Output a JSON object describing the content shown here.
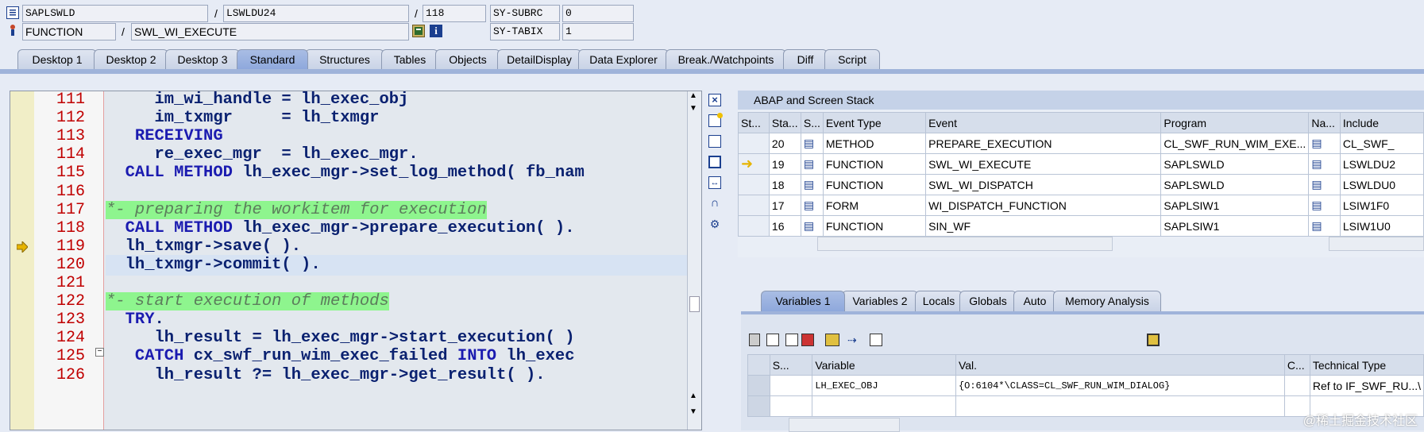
{
  "header": {
    "program": "SAPLSWLD",
    "include": "LSWLDU24",
    "line": "118",
    "sy_subrc_label": "SY-SUBRC",
    "sy_subrc_value": "0",
    "event_type": "FUNCTION",
    "event": "SWL_WI_EXECUTE",
    "sy_tabix_label": "SY-TABIX",
    "sy_tabix_value": "1",
    "slash": "/"
  },
  "tabs": [
    {
      "label": "Desktop 1"
    },
    {
      "label": "Desktop 2"
    },
    {
      "label": "Desktop 3"
    },
    {
      "label": "Standard",
      "active": true
    },
    {
      "label": "Structures"
    },
    {
      "label": "Tables"
    },
    {
      "label": "Objects"
    },
    {
      "label": "DetailDisplay"
    },
    {
      "label": "Data Explorer"
    },
    {
      "label": "Break./Watchpoints"
    },
    {
      "label": "Diff"
    },
    {
      "label": "Script"
    }
  ],
  "code": {
    "current_line": "118",
    "lines": [
      {
        "num": "111",
        "text": "     im_wi_handle = lh_exec_obj"
      },
      {
        "num": "112",
        "text": "     im_txmgr     = lh_txmgr"
      },
      {
        "num": "113",
        "text": "   RECEIVING"
      },
      {
        "num": "114",
        "text": "     re_exec_mgr  = lh_exec_mgr."
      },
      {
        "num": "115",
        "text": "  CALL METHOD lh_exec_mgr->set_log_method( fb_nam"
      },
      {
        "num": "116",
        "text": ""
      },
      {
        "num": "117",
        "text": "*- preparing the workitem for execution"
      },
      {
        "num": "118",
        "text": "  CALL METHOD lh_exec_mgr->prepare_execution( )."
      },
      {
        "num": "119",
        "text": "  lh_txmgr->save( )."
      },
      {
        "num": "120",
        "text": "  lh_txmgr->commit( )."
      },
      {
        "num": "121",
        "text": ""
      },
      {
        "num": "122",
        "text": "*- start execution of methods"
      },
      {
        "num": "123",
        "text": "  TRY."
      },
      {
        "num": "124",
        "text": "     lh_result = lh_exec_mgr->start_execution( )"
      },
      {
        "num": "125",
        "text": "   CATCH cx_swf_run_wim_exec_failed INTO lh_exec"
      },
      {
        "num": "126",
        "text": "     lh_result ?= lh_exec_mgr->get_result( )."
      }
    ]
  },
  "stack": {
    "title": "ABAP and Screen Stack",
    "columns": [
      "St...",
      "Sta...",
      "S...",
      "Event Type",
      "Event",
      "Program",
      "Na...",
      "Include"
    ],
    "rows": [
      {
        "level": "20",
        "type": "METHOD",
        "event": "PREPARE_EXECUTION",
        "program": "CL_SWF_RUN_WIM_EXE...",
        "include": "CL_SWF_",
        "current": false
      },
      {
        "level": "19",
        "type": "FUNCTION",
        "event": "SWL_WI_EXECUTE",
        "program": "SAPLSWLD",
        "include": "LSWLDU2",
        "current": true
      },
      {
        "level": "18",
        "type": "FUNCTION",
        "event": "SWL_WI_DISPATCH",
        "program": "SAPLSWLD",
        "include": "LSWLDU0",
        "current": false
      },
      {
        "level": "17",
        "type": "FORM",
        "event": "WI_DISPATCH_FUNCTION",
        "program": "SAPLSIW1",
        "include": "LSIW1F0",
        "current": false
      },
      {
        "level": "16",
        "type": "FUNCTION",
        "event": "SIN_WF",
        "program": "SAPLSIW1",
        "include": "LSIW1U0",
        "current": false
      }
    ]
  },
  "var_tabs": [
    {
      "label": "Variables 1",
      "active": true
    },
    {
      "label": "Variables 2"
    },
    {
      "label": "Locals"
    },
    {
      "label": "Globals"
    },
    {
      "label": "Auto"
    },
    {
      "label": "Memory Analysis"
    }
  ],
  "variables": {
    "columns": [
      "S...",
      "Variable",
      "Val.",
      "C...",
      "Technical Type"
    ],
    "rows": [
      {
        "name": "LH_EXEC_OBJ",
        "value": "{O:6104*\\CLASS=CL_SWF_RUN_WIM_DIALOG}",
        "type": "Ref to IF_SWF_RU...\\"
      }
    ]
  },
  "watermark": "@稀土掘金技术社区"
}
